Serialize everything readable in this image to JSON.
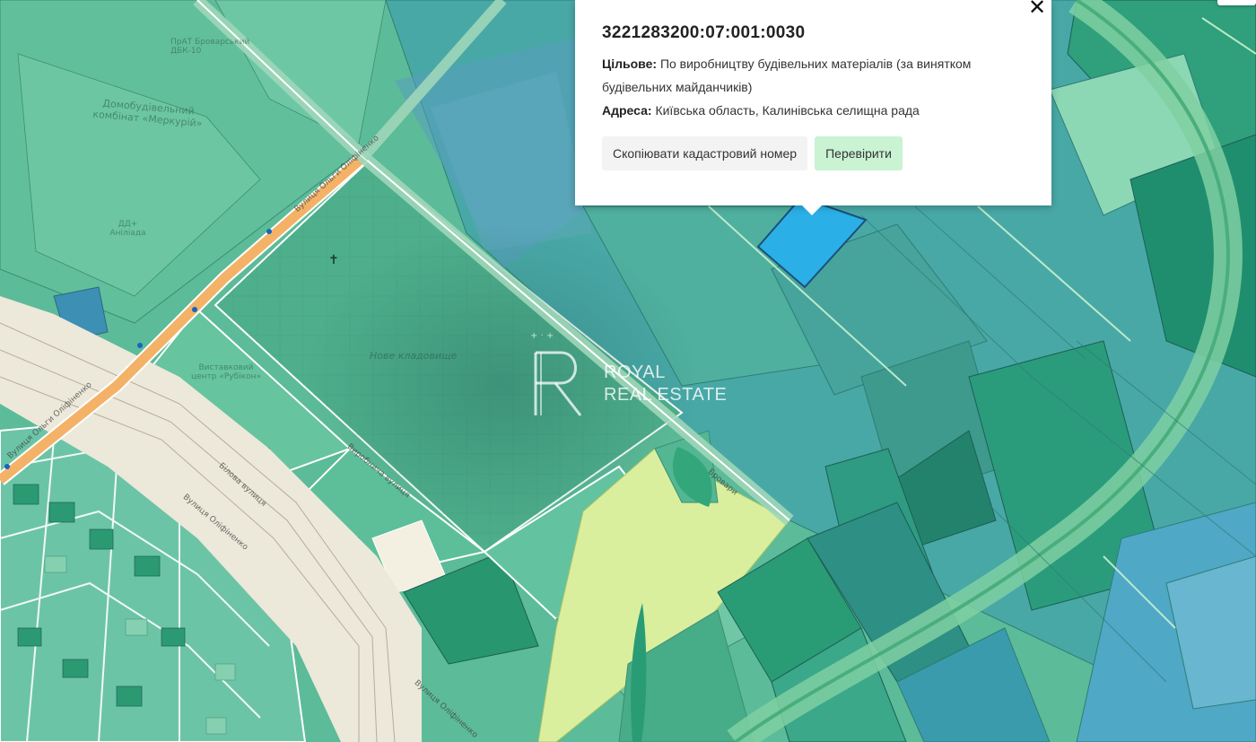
{
  "popup": {
    "cadastral_number": "3221283200:07:001:0030",
    "purpose_label": "Цільове:",
    "purpose_value": "По виробництву будівельних матеріалів (за винятком будівельних майданчиків)",
    "address_label": "Адреса:",
    "address_value": "Київська область, Калинівська селищна рада",
    "copy_button": "Скопіювати кадастровий номер",
    "check_button": "Перевірити",
    "close_icon": "close-icon"
  },
  "watermark": {
    "line1": "ROYAL",
    "line2": "REAL ESTATE"
  },
  "map_labels": {
    "complex": "Домобудівельний комбінат «Меркурій»",
    "cemetery": "Нове кладовище",
    "prat": "ПрАТ Броварський ДБК-10",
    "dd": "ДД+ Аніліада",
    "rubikon": "Виставковий центр «Рубікон»"
  },
  "street_labels": {
    "olha_1": "Вулиця Ольги Оліфіненко",
    "olha_2": "Вулиця Ольги Оліфіненко",
    "olha_3": "Вулиця Оліфіненко",
    "industrial": "Виробнича вулиця",
    "bilova": "Білова вулиця",
    "brovary": "Бровари",
    "vulytsia": "Вулиця Оліфіненко"
  },
  "colors": {
    "selected_parcel": "#2ab0e6",
    "parcel_border": "#1f6e5a",
    "road": "#f3b267",
    "railway_bg": "#ece8da",
    "light_parcel": "#d9ef9e",
    "ring_road": "#5bbf86"
  }
}
